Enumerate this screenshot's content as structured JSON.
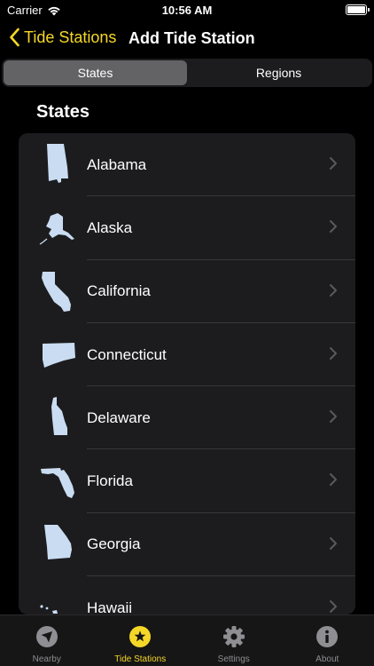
{
  "status_bar": {
    "carrier": "Carrier",
    "time": "10:56 AM"
  },
  "nav": {
    "back_label": "Tide Stations",
    "title": "Add Tide Station"
  },
  "segments": [
    {
      "label": "States",
      "selected": true
    },
    {
      "label": "Regions",
      "selected": false
    }
  ],
  "section_title": "States",
  "states": [
    {
      "name": "Alabama",
      "icon": "alabama-map-icon"
    },
    {
      "name": "Alaska",
      "icon": "alaska-map-icon"
    },
    {
      "name": "California",
      "icon": "california-map-icon"
    },
    {
      "name": "Connecticut",
      "icon": "connecticut-map-icon"
    },
    {
      "name": "Delaware",
      "icon": "delaware-map-icon"
    },
    {
      "name": "Florida",
      "icon": "florida-map-icon"
    },
    {
      "name": "Georgia",
      "icon": "georgia-map-icon"
    },
    {
      "name": "Hawaii",
      "icon": "hawaii-map-icon"
    }
  ],
  "tabs": [
    {
      "label": "Nearby",
      "icon": "location-arrow-icon",
      "selected": false
    },
    {
      "label": "Tide Stations",
      "icon": "star-icon",
      "selected": true
    },
    {
      "label": "Settings",
      "icon": "gear-icon",
      "selected": false
    },
    {
      "label": "About",
      "icon": "info-icon",
      "selected": false
    }
  ],
  "colors": {
    "accent": "#f5d728",
    "background": "#000000",
    "cell": "#1c1c1e",
    "map_fill": "#c9dcf2",
    "inactive": "#8e8e93"
  }
}
